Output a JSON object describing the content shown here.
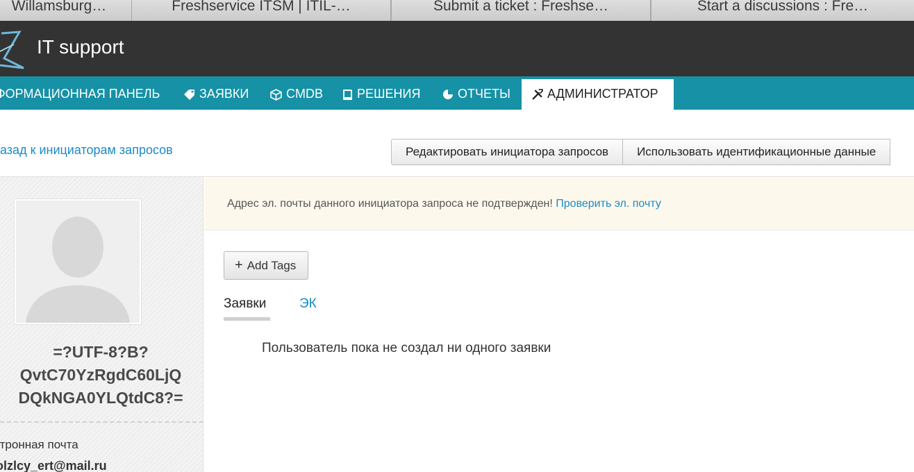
{
  "browser_tabs": [
    {
      "label": "Willamsburg…"
    },
    {
      "label": "Freshservice ITSM | ITIL-…"
    },
    {
      "label": "Submit a ticket : Freshse…"
    },
    {
      "label": "Start a discussions : Fre…"
    }
  ],
  "header": {
    "app_title": "IT support"
  },
  "nav": {
    "items": [
      {
        "label": "ФОРМАЦИОННАЯ ПАНЕЛЬ",
        "icon": "dashboard-icon"
      },
      {
        "label": "ЗАЯВКИ",
        "icon": "ticket-icon"
      },
      {
        "label": "CMDB",
        "icon": "cube-icon"
      },
      {
        "label": "РЕШЕНИЯ",
        "icon": "book-icon"
      },
      {
        "label": "ОТЧЕТЫ",
        "icon": "pie-chart-icon"
      },
      {
        "label": "АДМИНИСТРАТОР",
        "icon": "tools-icon",
        "active": true
      }
    ]
  },
  "back_link": "азад к инициаторам запросов",
  "actions": {
    "edit_label": "Редактировать инициатора запросов",
    "impersonate_label": "Использовать идентификационные данные"
  },
  "profile": {
    "name_lines": [
      "=?UTF-8?B?",
      "QvtC70YzRgdC60LjQ",
      "DQkNGA0YLQtdC8?="
    ],
    "email_label": "ктронная почта",
    "email_value": "olzlcy_ert@mail.ru"
  },
  "warning": {
    "text": "Адрес эл. почты данного инициатора запроса не подтвержден! ",
    "link": "Проверить эл. почту"
  },
  "tags": {
    "add_label": "Add Tags"
  },
  "content_tabs": {
    "tickets": "Заявки",
    "ek": "ЭК"
  },
  "empty_message": "Пользователь пока не создал ни одного заявки",
  "colors": {
    "nav_bg": "#1691a6",
    "appbar_bg": "#333333",
    "link": "#1b8bc4",
    "warning_bg": "#fdf8ec"
  }
}
